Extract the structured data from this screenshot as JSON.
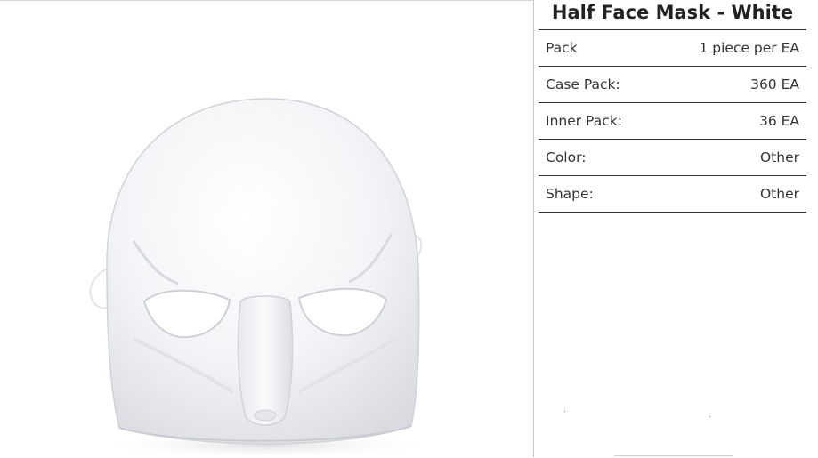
{
  "product": {
    "title": "Half Face Mask - White",
    "image_alt": "White half face mask",
    "specs": [
      {
        "label": "Pack",
        "value": "1 piece per EA"
      },
      {
        "label": "Case Pack:",
        "value": "360 EA"
      },
      {
        "label": "Inner Pack:",
        "value": "36 EA"
      },
      {
        "label": "Color:",
        "value": "Other"
      },
      {
        "label": "Shape:",
        "value": "Other"
      }
    ]
  }
}
